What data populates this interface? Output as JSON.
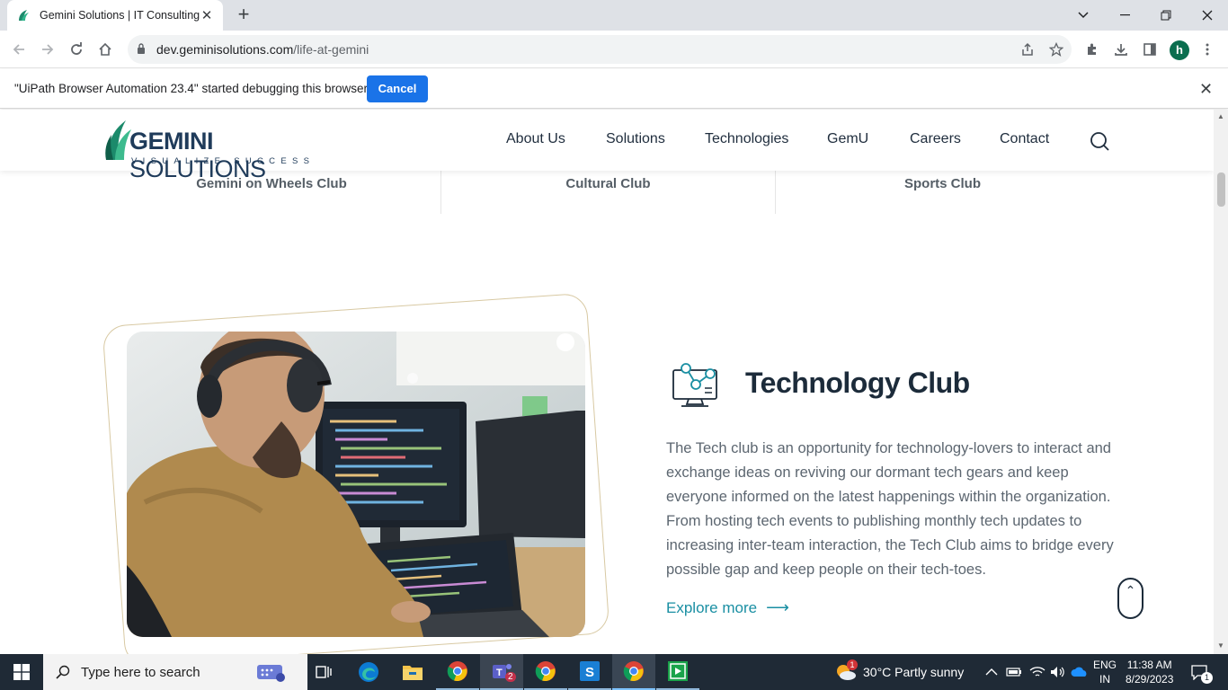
{
  "browser": {
    "tab_title": "Gemini Solutions | IT Consulting,",
    "url_host": "dev.geminisolutions.com",
    "url_path": "/life-at-gemini",
    "profile_initial": "h",
    "infobar_message": "\"UiPath Browser Automation 23.4\" started debugging this browser",
    "infobar_cancel": "Cancel"
  },
  "site": {
    "logo_brand_a": "GEMINI",
    "logo_brand_b": " SOLUTIONS",
    "logo_tagline": "VISUALIZE SUCCESS",
    "nav": [
      "About Us",
      "Solutions",
      "Technologies",
      "GemU",
      "Careers",
      "Contact"
    ],
    "clubs": [
      "Gemini on Wheels Club",
      "Cultural Club",
      "Sports Club"
    ],
    "section": {
      "title": "Technology Club",
      "description": "The Tech club is an opportunity for technology-lovers to interact and exchange ideas on reviving our dormant tech gears and keep everyone informed on the latest happenings within the organization. From hosting tech events to publishing monthly tech updates to increasing inter-team interaction, the Tech Club aims to bridge every possible gap and keep people on their tech-toes.",
      "cta": "Explore more"
    }
  },
  "taskbar": {
    "search_placeholder": "Type here to search",
    "weather": "30°C  Partly sunny",
    "weather_badge": "1",
    "lang_top": "ENG",
    "lang_bottom": "IN",
    "time": "11:38 AM",
    "date": "8/29/2023",
    "teams_badge": "2",
    "notification_count": "1"
  },
  "colors": {
    "accent_blue": "#1a73e8",
    "brand_navy": "#1f3b5a",
    "brand_teal": "#1a8fa3",
    "frame_gold": "#d8c9a3"
  }
}
